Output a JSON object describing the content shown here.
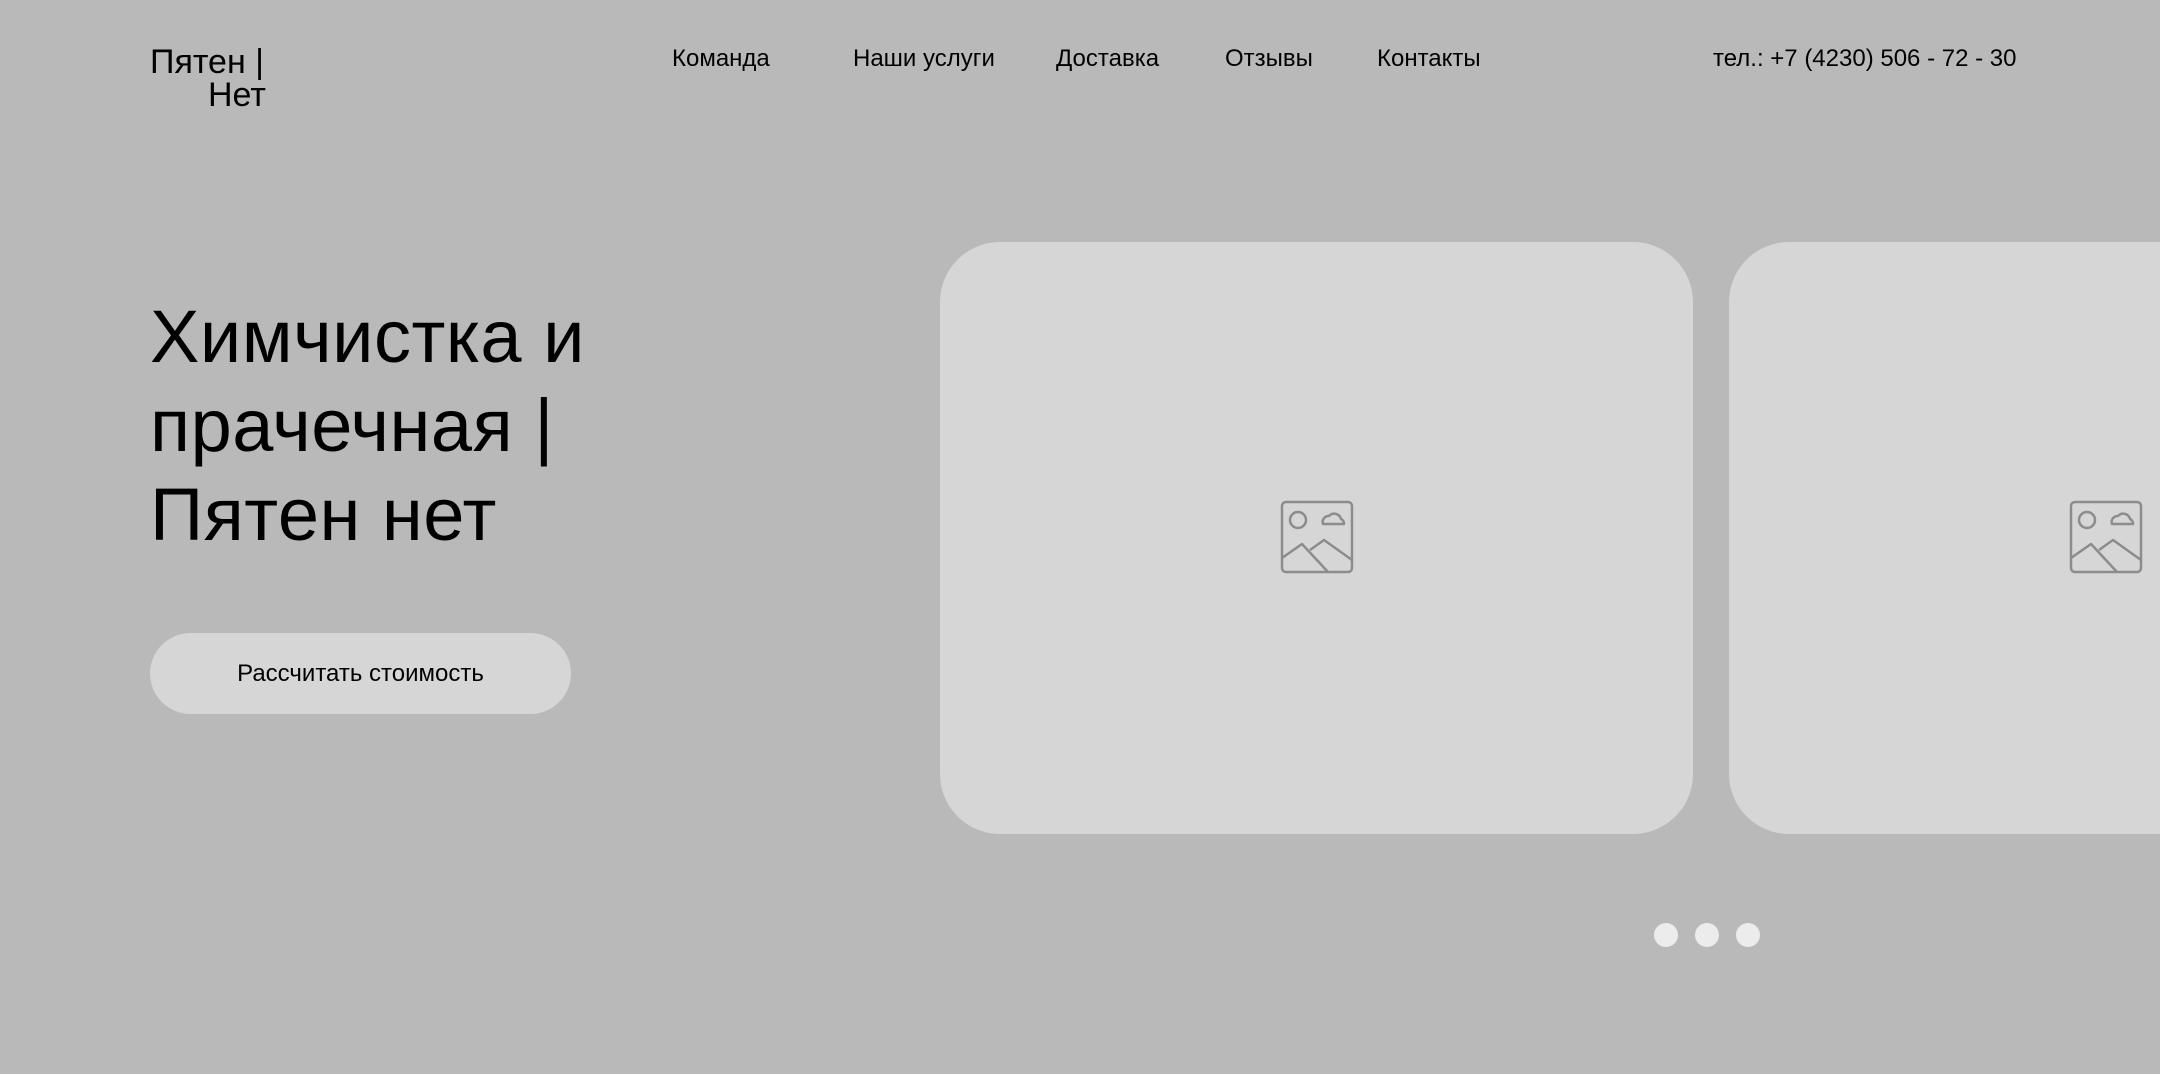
{
  "logo": {
    "line1": "Пятен |",
    "line2": "Нет"
  },
  "nav": {
    "items": [
      {
        "label": "Команда"
      },
      {
        "label": "Наши услуги"
      },
      {
        "label": "Доставка"
      },
      {
        "label": "Отзывы"
      },
      {
        "label": "Контакты"
      }
    ]
  },
  "header": {
    "phone": "тел.: +7 (4230) 506 - 72 - 30"
  },
  "hero": {
    "title_lines": [
      "Химчистка и",
      "прачечная |",
      "Пятен нет"
    ],
    "cta_label": "Рассчитать стоимость"
  },
  "slider": {
    "slides": [
      {
        "icon": "image-placeholder-icon"
      },
      {
        "icon": "image-placeholder-icon"
      }
    ],
    "dots_count": 3
  },
  "colors": {
    "background": "#b9b9b9",
    "surface": "#d6d6d6",
    "dot": "#ececec",
    "icon_stroke": "#8c8c8c",
    "text": "#000000"
  }
}
